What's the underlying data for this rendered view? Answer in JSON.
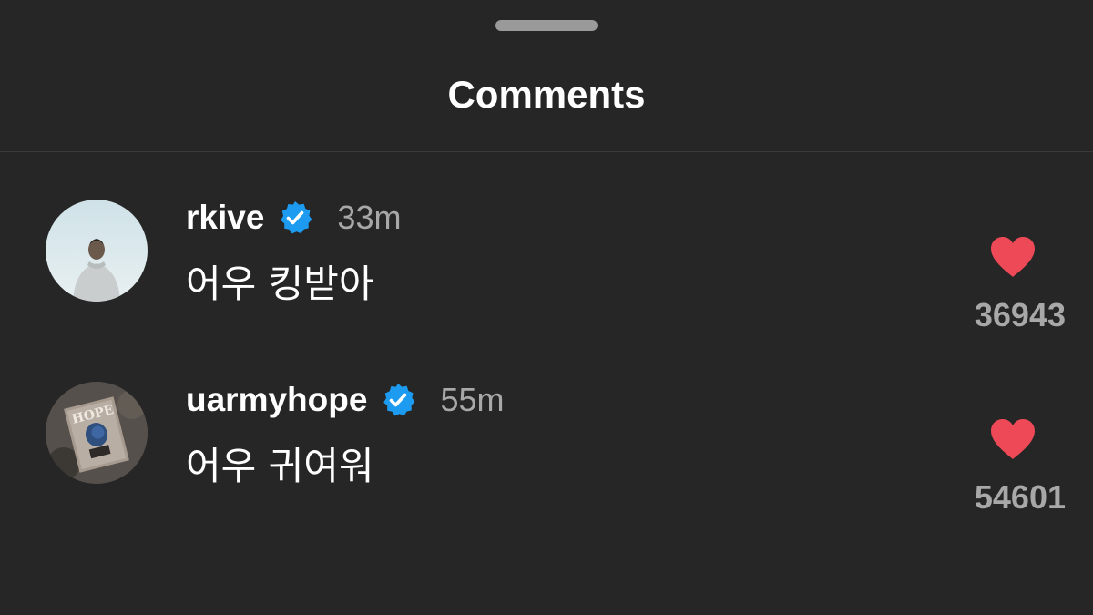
{
  "header": {
    "title": "Comments"
  },
  "comments": [
    {
      "username": "rkive",
      "verified": true,
      "time": "33m",
      "text": "어우 킹받아",
      "likes": "36943",
      "liked": true,
      "avatar_icon": "person-photo-icon"
    },
    {
      "username": "uarmyhope",
      "verified": true,
      "time": "55m",
      "text": "어우 귀여워",
      "likes": "54601",
      "liked": true,
      "avatar_icon": "album-cover-icon"
    }
  ],
  "colors": {
    "background": "#262626",
    "verified": "#1d9bf0",
    "heart": "#ed4956",
    "secondary_text": "#a8a8a8"
  }
}
